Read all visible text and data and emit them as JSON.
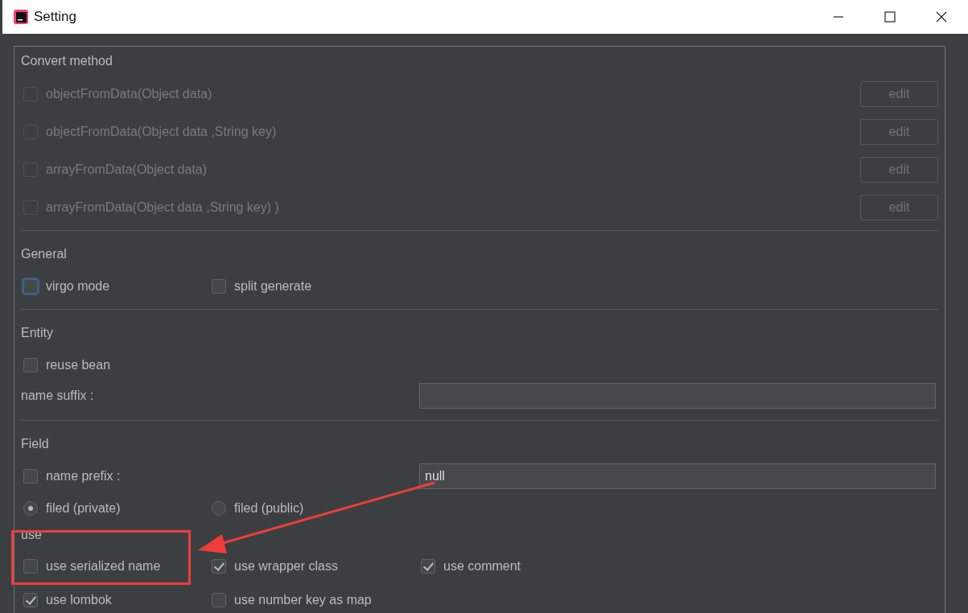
{
  "window": {
    "title": "Setting"
  },
  "convert_method": {
    "title": "Convert method",
    "methods": [
      {
        "label": "objectFromData(Object data)",
        "checked": false,
        "disabled": true,
        "button": "edit"
      },
      {
        "label": "objectFromData(Object data ,String key)",
        "checked": false,
        "disabled": true,
        "button": "edit"
      },
      {
        "label": "arrayFromData(Object data)",
        "checked": false,
        "disabled": true,
        "button": "edit"
      },
      {
        "label": "arrayFromData(Object data ,String key) )",
        "checked": false,
        "disabled": true,
        "button": "edit"
      }
    ]
  },
  "general": {
    "title": "General",
    "options": [
      {
        "label": "virgo mode",
        "checked": false,
        "focused": true
      },
      {
        "label": "split generate",
        "checked": false,
        "focused": false
      }
    ]
  },
  "entity": {
    "title": "Entity",
    "options": [
      {
        "label": "reuse bean",
        "checked": false
      }
    ],
    "name_suffix": {
      "label": "name suffix :"
    }
  },
  "field": {
    "title": "Field",
    "name_prefix": {
      "label": "name prefix :",
      "checked": false,
      "value": "null"
    },
    "visibility": [
      {
        "label": "filed (private)",
        "selected": true
      },
      {
        "label": "filed (public)",
        "selected": false
      }
    ]
  },
  "use": {
    "title": "use",
    "options": [
      {
        "label": "use serialized name",
        "checked": false
      },
      {
        "label": "use wrapper class",
        "checked": true
      },
      {
        "label": "use comment",
        "checked": true
      },
      {
        "label": "use lombok",
        "checked": true
      },
      {
        "label": "use number key as map",
        "checked": false
      }
    ]
  }
}
